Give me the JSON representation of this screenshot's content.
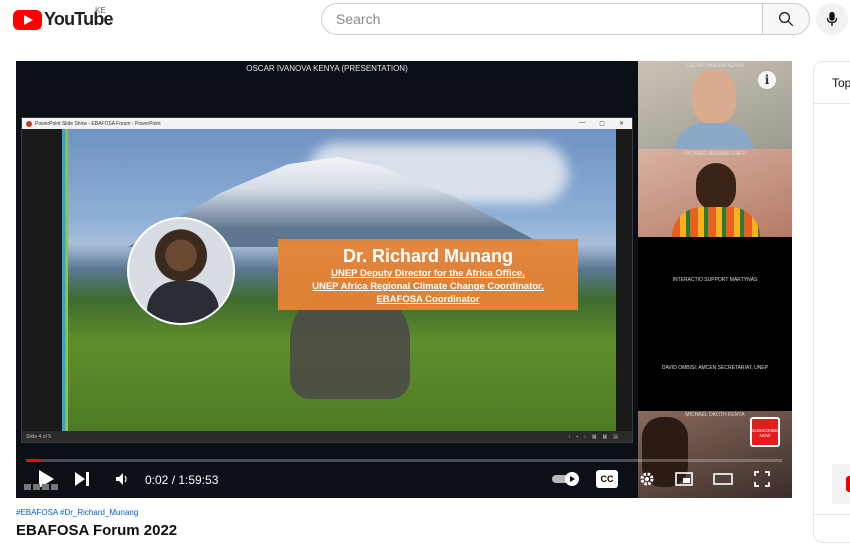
{
  "header": {
    "logo_text": "YouTube",
    "country_code": "KE",
    "search_placeholder": "Search"
  },
  "player": {
    "presentation_label": "OSCAR IVANOVA KENYA (PRESENTATION)",
    "ppt_window_title": "PowerPoint Slide Show - EBAFOSA Forum - PowerPoint",
    "ppt_status_left": "Slide 4 of 5",
    "slide": {
      "name": "Dr. Richard Munang",
      "title_lines": [
        "UNEP Deputy Director for the Africa Office,",
        "UNEP Africa Regional Climate Change Coordinator,",
        "EBAFOSA Coordinator"
      ]
    },
    "tiles": [
      {
        "label": "OSCAR IVANOVA KENYA"
      },
      {
        "label": "RICHARD MUNANG UNEP"
      },
      {
        "label": "INTERACTIO SUPPORT MARTYNAS"
      },
      {
        "label": "DAVID OMBISI: AMCEN SECRETARIAT, UNEP"
      },
      {
        "label": "MICHAEL OKOTH KENYA",
        "badge": "SUBSCRIBE NOW"
      }
    ],
    "time_display": "0:02 / 1:59:53",
    "progress_fraction": 0.02,
    "cc_label": "CC"
  },
  "video": {
    "hashtags": "#EBAFOSA #Dr_Richard_Munang",
    "title": "EBAFOSA Forum 2022"
  },
  "side_panel": {
    "heading": "Top"
  },
  "colors": {
    "brand_red": "#ff0000",
    "link_blue": "#065fd4",
    "name_card_orange": "#e98434"
  }
}
